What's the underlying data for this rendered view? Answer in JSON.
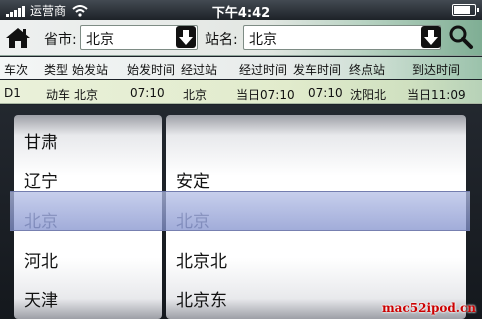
{
  "status_bar": {
    "carrier": "运营商",
    "time": "下午4:42",
    "signal_icon": "signal-bars-icon",
    "wifi_icon": "wifi-icon",
    "battery_icon": "battery-icon",
    "battery_level": 0.85
  },
  "search": {
    "home_icon": "home-icon",
    "province_label": "省市:",
    "province_value": "北京",
    "station_label": "站名:",
    "station_value": "北京",
    "search_icon": "search-icon"
  },
  "table": {
    "headers": [
      "车次",
      "类型",
      "始发站",
      "始发时间",
      "经过站",
      "经过时间",
      "发车时间",
      "终点站",
      "到达时间"
    ],
    "rows": [
      [
        "D1",
        "动车",
        "北京",
        "07:10",
        "北京",
        "当日07:10",
        "07:10",
        "沈阳北",
        "当日11:09"
      ]
    ]
  },
  "picker": {
    "provinces": [
      "甘肃",
      "辽宁",
      "北京",
      "河北",
      "天津"
    ],
    "stations": [
      "",
      "安定",
      "北京",
      "北京北",
      "北京东"
    ],
    "selected_index": 2
  },
  "watermark": "mac52ipod.cn"
}
